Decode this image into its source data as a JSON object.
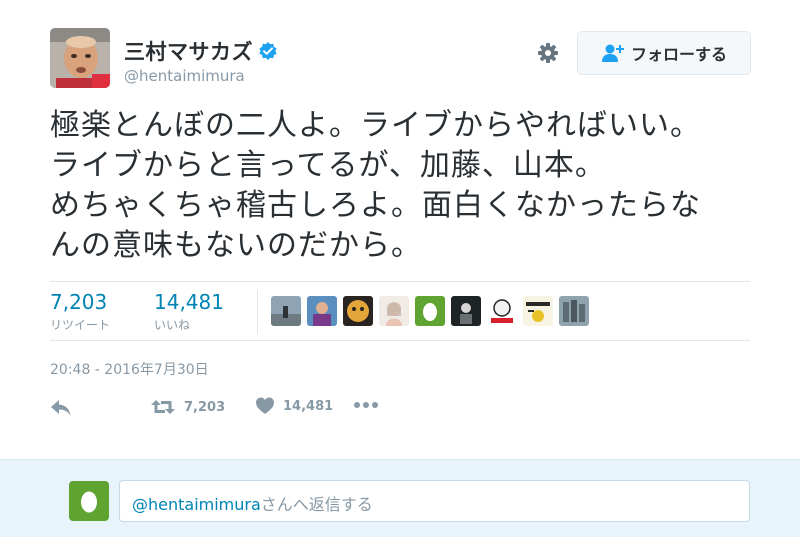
{
  "user": {
    "display_name": "三村マサカズ",
    "handle": "@hentaimimura",
    "verified": true
  },
  "actions_top": {
    "follow_label": "フォローする",
    "gear_icon": "gear-icon",
    "follow_icon": "add-user-icon"
  },
  "tweet": {
    "lines": [
      "極楽とんぼの二人よ。ライブからやればいい。",
      "ライブからと言ってるが、加藤、山本。",
      "めちゃくちゃ稽古しろよ。面白くなかったらな",
      "んの意味もないのだから。"
    ]
  },
  "stats": {
    "retweets": "7,203",
    "retweets_label": "リツイート",
    "likes": "14,481",
    "likes_label": "いいね"
  },
  "timestamp": "20:48 - 2016年7月30日",
  "action_bar": {
    "reply_icon": "reply-icon",
    "retweet_count": "7,203",
    "like_count": "14,481",
    "more_icon": "more-icon"
  },
  "reply": {
    "mention": "@hentaimimura",
    "placeholder_suffix": "さんへ返信する"
  },
  "colors": {
    "accent": "#0084b4",
    "muted": "#8899a6",
    "verified_blue": "#1da1f2",
    "reply_bg": "#e8f4fb",
    "egg_green": "#5fa331"
  }
}
